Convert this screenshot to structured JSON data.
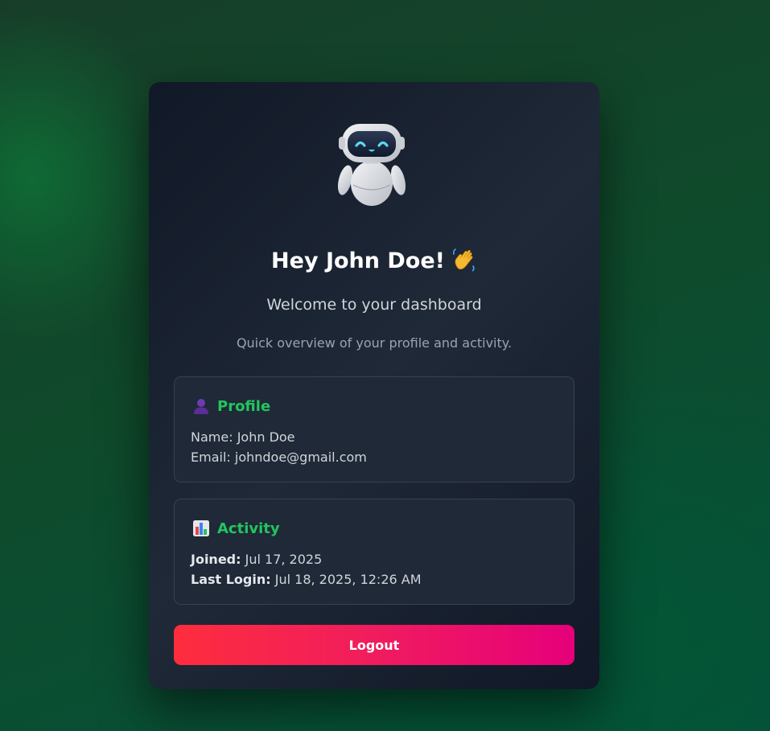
{
  "header": {
    "avatar_icon": "robot-icon",
    "greeting": "Hey John Doe!",
    "greeting_icon": "waving-hand-icon",
    "subtitle": "Welcome to your dashboard",
    "overview": "Quick overview of your profile and activity."
  },
  "profile": {
    "icon": "bust-silhouette-icon",
    "title": "Profile",
    "name_label": "Name:",
    "name_value": "John Doe",
    "email_label": "Email:",
    "email_value": "johndoe@gmail.com"
  },
  "activity": {
    "icon": "bar-chart-icon",
    "title": "Activity",
    "joined_label": "Joined:",
    "joined_value": "Jul 17, 2025",
    "last_login_label": "Last Login:",
    "last_login_value": "Jul 18, 2025, 12:26 AM"
  },
  "actions": {
    "logout_label": "Logout"
  },
  "colors": {
    "accent": "#22c55e",
    "logout_start": "#fe2d3d",
    "logout_end": "#e6007a",
    "card_bg": "#1f2937"
  }
}
